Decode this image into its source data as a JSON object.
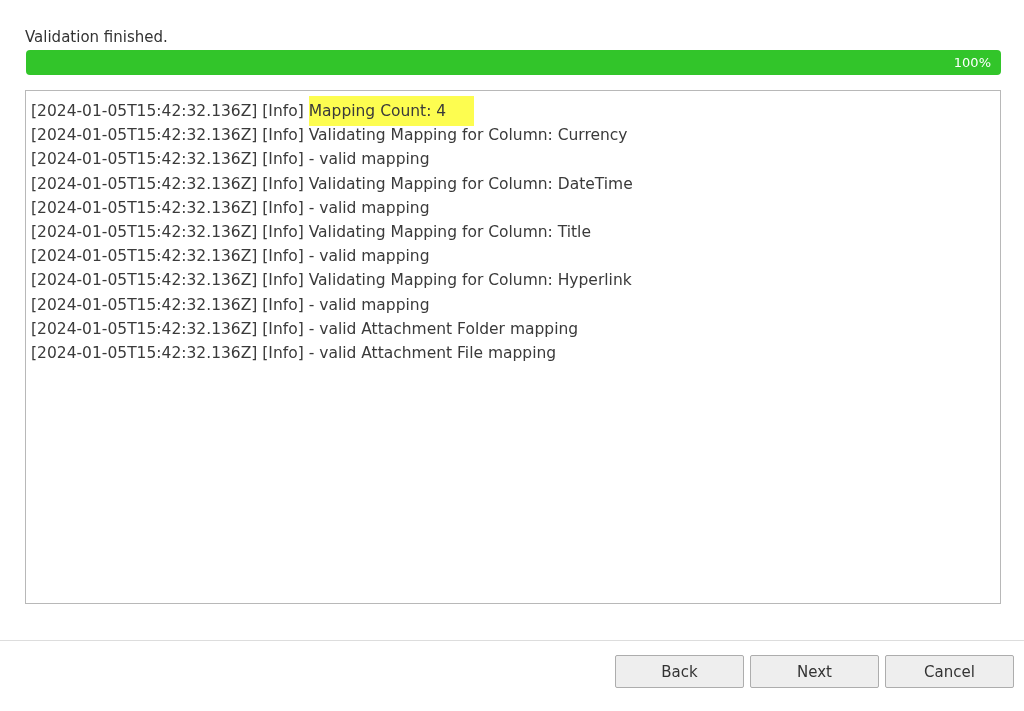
{
  "status": "Validation finished.",
  "progress": {
    "level": 1,
    "reading": "100%"
  },
  "log": [
    {
      "prefix": "[2024-01-05T15:42:32.136Z] [Info]",
      "message": "Mapping Count: 4",
      "highlighted": true
    },
    {
      "prefix": "[2024-01-05T15:42:32.136Z] [Info]",
      "message": "Validating Mapping for Column: Currency",
      "highlighted": false
    },
    {
      "prefix": "[2024-01-05T15:42:32.136Z] [Info]",
      "message": "- valid mapping",
      "highlighted": false
    },
    {
      "prefix": "[2024-01-05T15:42:32.136Z] [Info]",
      "message": "Validating Mapping for Column: DateTime",
      "highlighted": false
    },
    {
      "prefix": "[2024-01-05T15:42:32.136Z] [Info]",
      "message": "- valid mapping",
      "highlighted": false
    },
    {
      "prefix": "[2024-01-05T15:42:32.136Z] [Info]",
      "message": "Validating Mapping for Column: Title",
      "highlighted": false
    },
    {
      "prefix": "[2024-01-05T15:42:32.136Z] [Info]",
      "message": "- valid mapping",
      "highlighted": false
    },
    {
      "prefix": "[2024-01-05T15:42:32.136Z] [Info]",
      "message": "Validating Mapping for Column: Hyperlink",
      "highlighted": false
    },
    {
      "prefix": "[2024-01-05T15:42:32.136Z] [Info]",
      "message": "- valid mapping",
      "highlighted": false
    },
    {
      "prefix": "[2024-01-05T15:42:32.136Z] [Info]",
      "message": "- valid Attachment Folder mapping",
      "highlighted": false
    },
    {
      "prefix": "[2024-01-05T15:42:32.136Z] [Info]",
      "message": "- valid Attachment File mapping",
      "highlighted": false
    }
  ],
  "buttons": [
    "Back",
    "Next",
    "Cancel"
  ]
}
